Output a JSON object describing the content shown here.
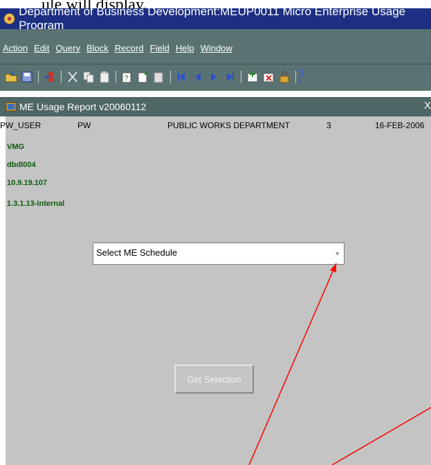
{
  "doc_text": "ule will display.",
  "app": {
    "title": "Department of Business Development:MEUP0011 Micro Enterprise Usage Program"
  },
  "menu": [
    "Action",
    "Edit",
    "Query",
    "Block",
    "Record",
    "Field",
    "Help",
    "Window"
  ],
  "toolbar": {
    "help_glyph": "?"
  },
  "inner_window": {
    "title": "ME Usage Report v20060112",
    "close": "X"
  },
  "header": {
    "user": "PW_USER",
    "code": "PW",
    "department": "PUBLIC WORKS DEPARTMENT",
    "number": "3",
    "date": "16-FEB-2006"
  },
  "info": [
    "VMG",
    "dbdl004",
    "10.9.19.107",
    "1.3.1.13-internal"
  ],
  "schedule_select": {
    "value": "Select ME Schedule"
  },
  "get_selection_button": {
    "label": "Get Selection"
  },
  "colors": {
    "title_bar": "#1c2f83",
    "menu_bar": "#5a7272",
    "panel": "#c4c4c4",
    "info_text": "#0b5a0b",
    "annotation_arrow": "#ff0000"
  }
}
